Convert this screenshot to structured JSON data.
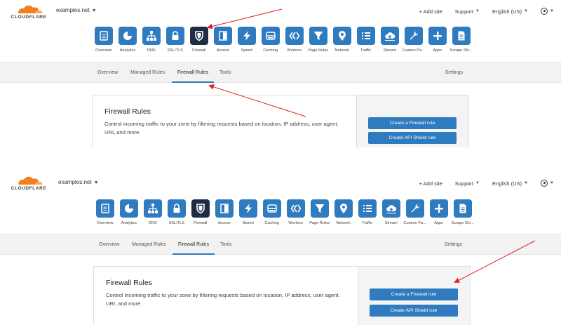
{
  "brand": {
    "logo_text": "CLOUDFLARE",
    "cloud_color": "#f38020"
  },
  "header": {
    "domain": "examples.net",
    "add_site": "+ Add site",
    "support": "Support",
    "language": "English (US)"
  },
  "icons": [
    {
      "label": "Overview",
      "icon": "overview-icon"
    },
    {
      "label": "Analytics",
      "icon": "analytics-icon"
    },
    {
      "label": "DNS",
      "icon": "dns-icon"
    },
    {
      "label": "SSL/TLS",
      "icon": "lock-icon"
    },
    {
      "label": "Firewall",
      "icon": "firewall-icon",
      "active": true
    },
    {
      "label": "Access",
      "icon": "access-icon"
    },
    {
      "label": "Speed",
      "icon": "lightning-icon"
    },
    {
      "label": "Caching",
      "icon": "caching-icon"
    },
    {
      "label": "Workers",
      "icon": "workers-icon"
    },
    {
      "label": "Page Rules",
      "icon": "filter-icon"
    },
    {
      "label": "Network",
      "icon": "location-pin-icon"
    },
    {
      "label": "Traffic",
      "icon": "list-icon"
    },
    {
      "label": "Stream",
      "icon": "cloud-upload-icon"
    },
    {
      "label": "Custom Pa...",
      "icon": "wrench-icon"
    },
    {
      "label": "Apps",
      "icon": "plus-icon"
    },
    {
      "label": "Scrape Shi...",
      "icon": "document-icon"
    }
  ],
  "subnav": {
    "tabs": [
      "Overview",
      "Managed Rules",
      "Firewall Rules",
      "Tools"
    ],
    "active": "Firewall Rules",
    "settings": "Settings"
  },
  "card": {
    "title": "Firewall Rules",
    "description": "Control incoming traffic to your zone by filtering requests based on location, IP address, user agent, URI, and more.",
    "primary_button": "Create a Firewall rule",
    "secondary_button": "Create API Shield rule"
  },
  "colors": {
    "accent": "#2f7bbf",
    "active_icon": "#1d2d44",
    "annotation_arrow": "#e02424"
  }
}
